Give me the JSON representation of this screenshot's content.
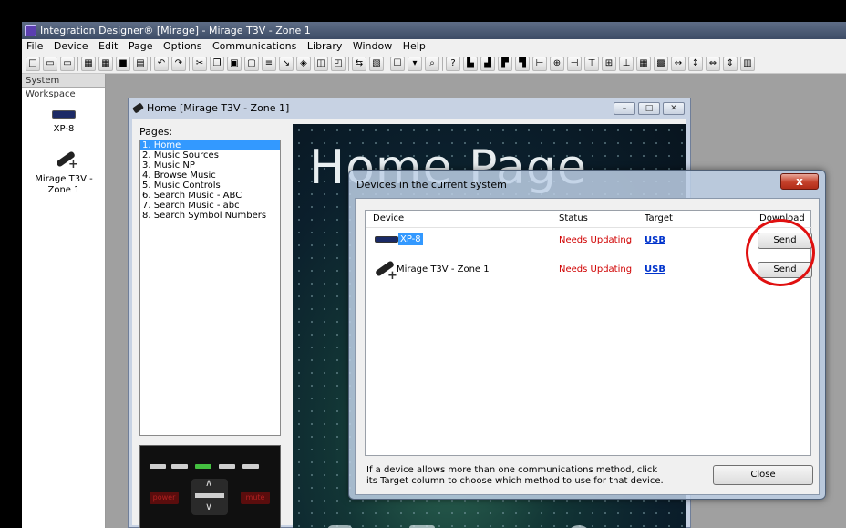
{
  "app": {
    "title": "Integration Designer® [Mirage] - Mirage T3V - Zone 1"
  },
  "menu": [
    "File",
    "Device",
    "Edit",
    "Page",
    "Options",
    "Communications",
    "Library",
    "Window",
    "Help"
  ],
  "workspace": {
    "title": "System Workspace",
    "items": [
      {
        "label": "XP-8",
        "icon": "controller-icon"
      },
      {
        "label": "Mirage T3V - Zone 1",
        "icon": "remote-icon"
      }
    ]
  },
  "home_window": {
    "title": "Home [Mirage T3V - Zone 1]",
    "pages_label": "Pages:",
    "pages": [
      "1. Home",
      "2. Music Sources",
      "3. Music NP",
      "4. Browse Music",
      "5. Music Controls",
      "6. Search Music - ABC",
      "7. Search Music - abc",
      "8. Search Symbol Numbers"
    ],
    "selected_page": 0,
    "canvas_title": "Home Page",
    "thumb": {
      "power": "power",
      "mute": "mute"
    }
  },
  "dialog": {
    "title": "Devices in the current system",
    "close_icon": "x",
    "columns": {
      "device": "Device",
      "status": "Status",
      "target": "Target",
      "download": "Download"
    },
    "rows": [
      {
        "device": "XP-8",
        "status": "Needs Updating",
        "target": "USB",
        "action": "Send"
      },
      {
        "device": "Mirage T3V - Zone 1",
        "status": "Needs Updating",
        "target": "USB",
        "action": "Send"
      }
    ],
    "help_text": "If a device allows more than one communications method, click its Target column to choose which method to use for that device.",
    "close_label": "Close"
  }
}
